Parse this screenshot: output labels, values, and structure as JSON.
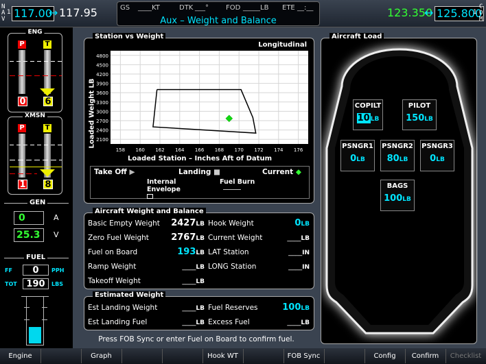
{
  "top": {
    "nav_left_letters": [
      "N",
      "A",
      "V"
    ],
    "nav_left_sub": "1",
    "nav_active": "117.00",
    "nav_arrow": "↔",
    "nav_standby": "117.95",
    "gs_label": "GS",
    "gs_value": "____KT",
    "dtk_label": "DTK",
    "dtk_value": "___°",
    "fod_label": "FOD",
    "fod_value": "_____LB",
    "ete_label": "ETE",
    "ete_value": "__:__",
    "title": "Aux – Weight and Balance",
    "com_active": "123.350",
    "com_arrow": "↔",
    "com_standby": "125.800",
    "com_right_letters": [
      "C",
      "O",
      "M"
    ],
    "com_right_sub": "1"
  },
  "eng": {
    "title": "ENG",
    "left_badge": "P",
    "right_badge": "T",
    "left_value": "0",
    "right_value": "6"
  },
  "xmsn": {
    "title": "XMSN",
    "left_badge": "P",
    "right_badge": "T",
    "left_value": "1",
    "right_value": "8"
  },
  "gen": {
    "title": "GEN",
    "amps": "0",
    "amps_unit": "A",
    "volts": "25.3",
    "volts_unit": "V"
  },
  "fuel": {
    "title": "FUEL",
    "ff_label": "FF",
    "ff_value": "0",
    "ff_unit": "PPH",
    "tot_label": "TOT",
    "tot_value": "190",
    "tot_unit": "LBS",
    "level_fraction": 0.35
  },
  "station_chart": {
    "title": "Station vs Weight",
    "mode": "Longitudinal",
    "ylabel": "Loaded Weight LB",
    "xlabel": "Loaded Station – Inches Aft of Datum",
    "legend": {
      "takeoff": "Take Off",
      "landing": "Landing",
      "current": "Current",
      "internal_envelope": "Internal Envelope",
      "fuel_burn": "Fuel Burn"
    }
  },
  "chart_data": {
    "type": "line",
    "title": "Station vs Weight",
    "xlabel": "Loaded Station – Inches Aft of Datum",
    "ylabel": "Loaded Weight LB",
    "xlim": [
      157,
      177
    ],
    "ylim": [
      1950,
      4950
    ],
    "x_ticks": [
      158,
      160,
      162,
      164,
      166,
      168,
      170,
      172,
      174,
      176
    ],
    "y_ticks": [
      2100,
      2400,
      2700,
      3000,
      3300,
      3600,
      3900,
      4200,
      4500,
      4800
    ],
    "envelope": {
      "x": [
        161.7,
        170.2,
        171.4,
        171.7,
        161.3,
        161.7
      ],
      "y": [
        3700,
        3700,
        2800,
        2300,
        2500,
        3700
      ]
    },
    "current_point": {
      "x": 169.0,
      "y": 2770
    }
  },
  "aircraft_load": {
    "title": "Aircraft Load",
    "copilot": {
      "label": "COPILT",
      "value": "10",
      "unit": "LB"
    },
    "pilot": {
      "label": "PILOT",
      "value": "150",
      "unit": "LB"
    },
    "psngr1": {
      "label": "PSNGR1",
      "value": "0",
      "unit": "LB"
    },
    "psngr2": {
      "label": "PSNGR2",
      "value": "80",
      "unit": "LB"
    },
    "psngr3": {
      "label": "PSNGR3",
      "value": "0",
      "unit": "LB"
    },
    "bags": {
      "label": "BAGS",
      "value": "100",
      "unit": "LB"
    }
  },
  "wb": {
    "title": "Aircraft Weight and Balance",
    "basic_empty_label": "Basic Empty Weight",
    "basic_empty_value": "2427",
    "unit_lb": "LB",
    "zero_fuel_label": "Zero Fuel Weight",
    "zero_fuel_value": "2767",
    "fob_label": "Fuel on Board",
    "fob_value": "193",
    "ramp_label": "Ramp Weight",
    "ramp_value": "____",
    "takeoff_label": "Takeoff Weight",
    "takeoff_value": "____",
    "hook_label": "Hook Weight",
    "hook_value": "0",
    "current_label": "Current Weight",
    "current_value": "____",
    "lat_label": "LAT Station",
    "lat_value": "____",
    "unit_in": "IN",
    "long_label": "LONG Station",
    "long_value": "____"
  },
  "est": {
    "title": "Estimated Weight",
    "landing_weight_label": "Est Landing Weight",
    "landing_weight_value": "____",
    "landing_fuel_label": "Est Landing Fuel",
    "landing_fuel_value": "____",
    "reserves_label": "Fuel Reserves",
    "reserves_value": "100",
    "excess_label": "Excess Fuel",
    "excess_value": "____",
    "unit_lb": "LB"
  },
  "message": "Press FOB Sync or enter Fuel on Board to confirm fuel.",
  "softkeys": [
    "Engine",
    "",
    "Graph",
    "",
    "",
    "Hook WT",
    "",
    "FOB Sync",
    "",
    "Config",
    "Confirm",
    "Checklist"
  ]
}
